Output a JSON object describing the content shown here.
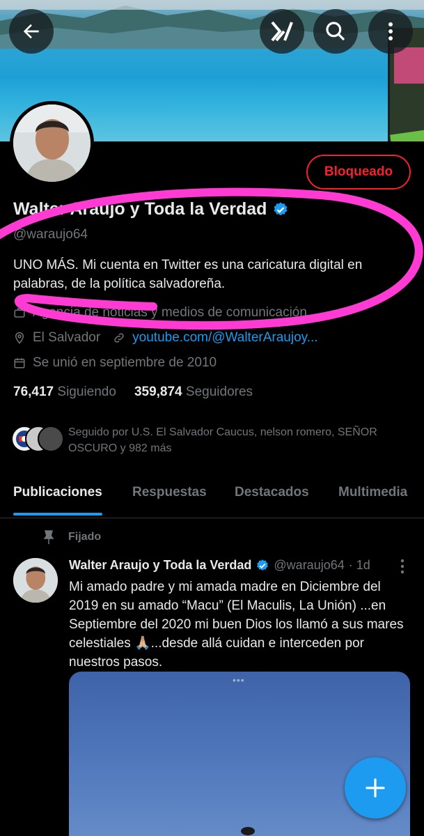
{
  "header": {
    "back_icon": "arrow-left-icon",
    "grok_icon": "grok-icon",
    "search_icon": "search-icon",
    "more_icon": "vertical-dots-icon"
  },
  "profile": {
    "blocked_label": "Bloqueado",
    "display_name": "Walter Araujo y Toda la Verdad",
    "handle": "@waraujo64",
    "bio": "UNO MÁS. Mi cuenta en Twitter es una caricatura digital en palabras, de la política salvadoreña.",
    "category": "Agencia de noticias y medios de comunicación",
    "location": "El Salvador",
    "link": "youtube.com/@WalterAraujoy...",
    "joined": "Se unió en septiembre de 2010",
    "following_count": "76,417",
    "following_label": "Siguiendo",
    "followers_count": "359,874",
    "followers_label": "Seguidores",
    "followed_by": "Seguido por U.S. El Salvador Caucus, nelson romero, SEÑOR OSCURO y 982 más"
  },
  "tabs": [
    {
      "label": "Publicaciones",
      "active": true
    },
    {
      "label": "Respuestas",
      "active": false
    },
    {
      "label": "Destacados",
      "active": false
    },
    {
      "label": "Multimedia",
      "active": false
    }
  ],
  "pinned_post": {
    "pinned_label": "Fijado",
    "author": "Walter Araujo y Toda la Verdad",
    "handle": "@waraujo64",
    "time": "· 1d",
    "text": "Mi amado padre y mi amada madre en Diciembre del 2019 en su amado “Macu” (El Maculis, La Unión) ...en Septiembre del 2020 mi buen Dios los llamó a sus mares celestiales 🙏🏼...desde allá cuidan e interceden por nuestros pasos.",
    "media_dots": "•••"
  },
  "colors": {
    "accent": "#1d9bf0",
    "blocked": "#f4212e",
    "annotation": "#ff3bd4",
    "muted": "#71767b"
  }
}
